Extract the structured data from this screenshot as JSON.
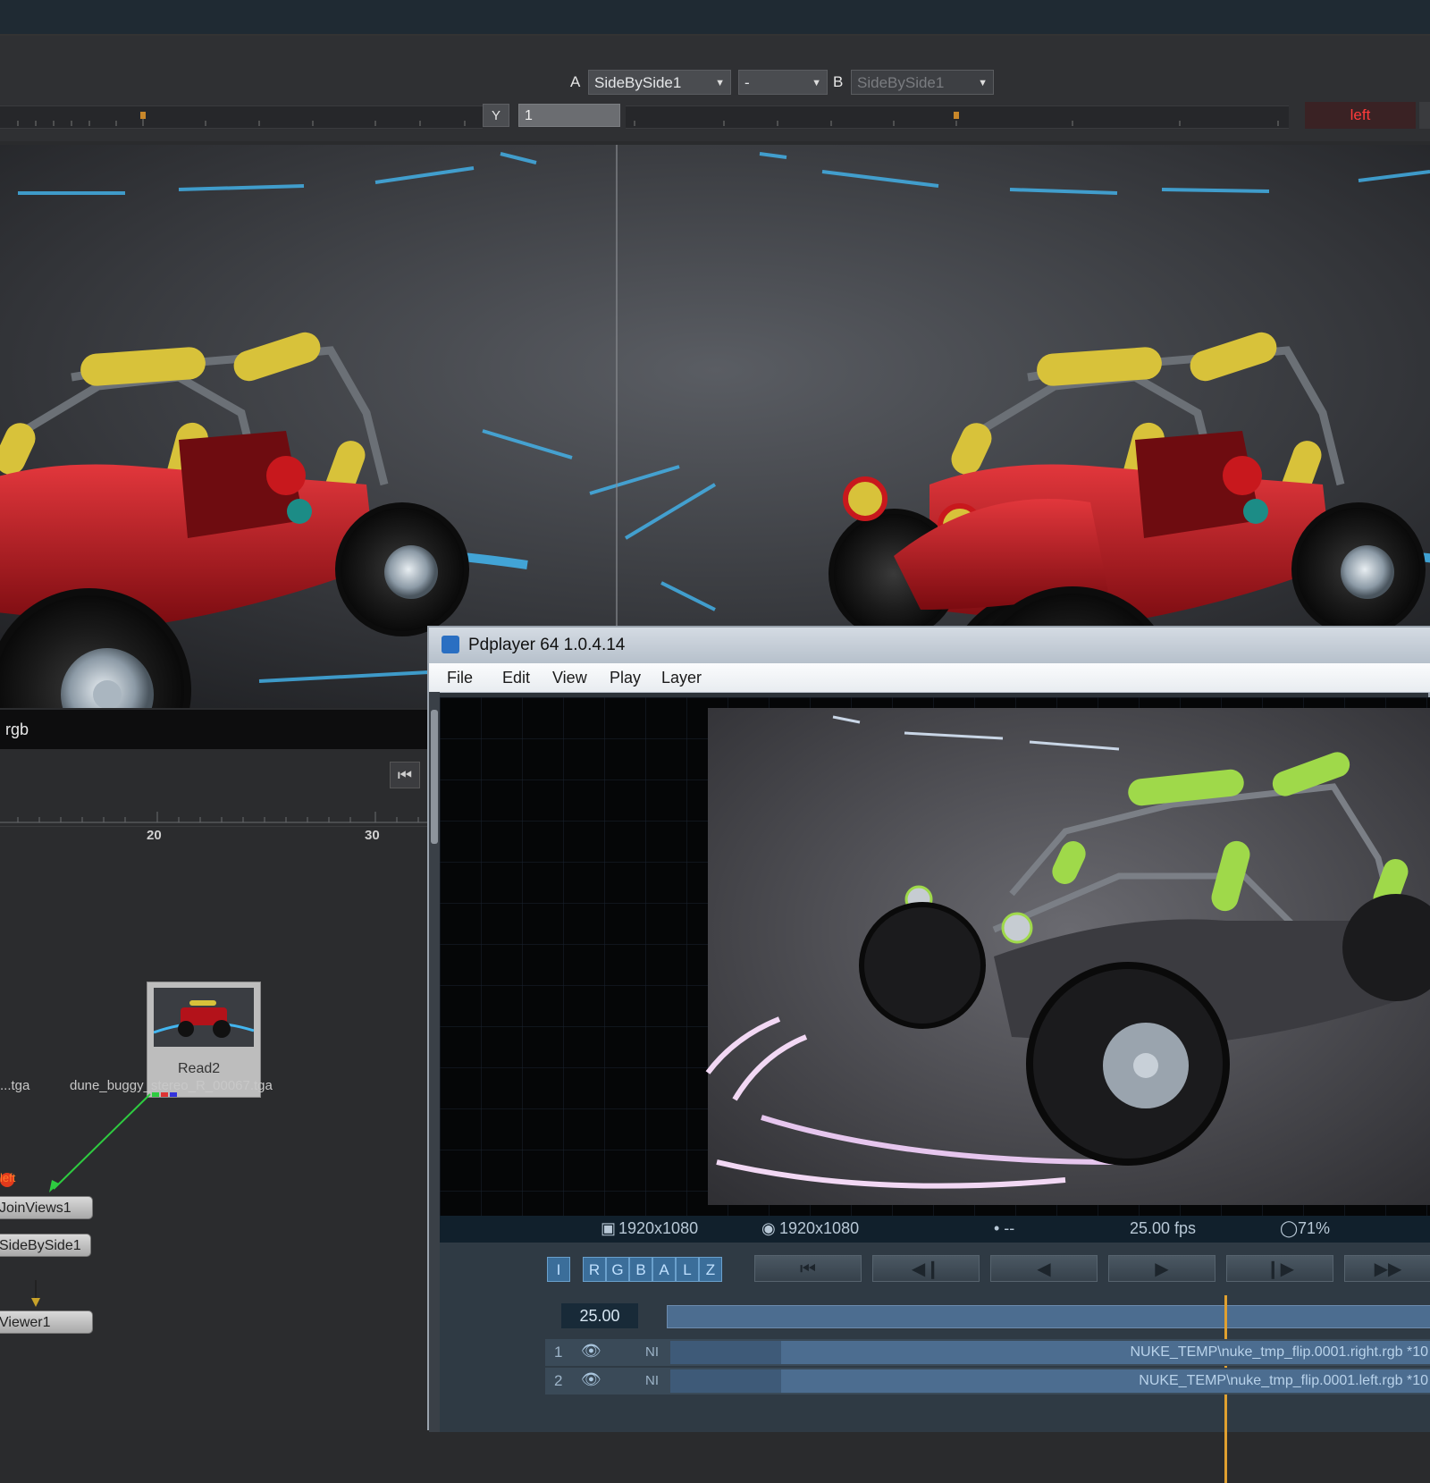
{
  "viewer_toolbar": {
    "a_label": "A",
    "a_input": "SideBySide1",
    "operation": "-",
    "b_label": "B",
    "b_input": "SideBySide1",
    "y_button": "Y",
    "y_value": "1",
    "view_button": "left"
  },
  "node_graph": {
    "channel_label": "rgb",
    "ruler_ticks": [
      "20",
      "30"
    ],
    "read_node": "Read2",
    "file_left": "...tga",
    "file_right": "dune_buggy_stereo_R_00067.tga",
    "view_tag": "left",
    "nodes": [
      "JoinViews1",
      "SideBySide1",
      "Viewer1"
    ]
  },
  "pdplayer": {
    "title": "Pdplayer 64 1.0.4.14",
    "menu": [
      "File",
      "Edit",
      "View",
      "Play",
      "Layer"
    ],
    "status": {
      "res1": "1920x1080",
      "res2": "1920x1080",
      "extra": "• --",
      "fps": "25.00 fps",
      "zoom": "71%"
    },
    "channels": [
      "I",
      "R",
      "G",
      "B",
      "A",
      "L",
      "Z"
    ],
    "frame_value": "25.00",
    "layers": [
      {
        "index": "1",
        "tag": "NI",
        "path": "NUKE_TEMP\\nuke_tmp_flip.0001.right.rgb *10"
      },
      {
        "index": "2",
        "tag": "NI",
        "path": "NUKE_TEMP\\nuke_tmp_flip.0001.left.rgb *10"
      }
    ],
    "playhead_fraction": 0.73
  },
  "colors": {
    "buggy_red": "#b3121a",
    "roll_bar_yellow": "#d8c23a",
    "stage_cyan": "#43b6f0",
    "anaglyph_green": "#9fd94a"
  }
}
